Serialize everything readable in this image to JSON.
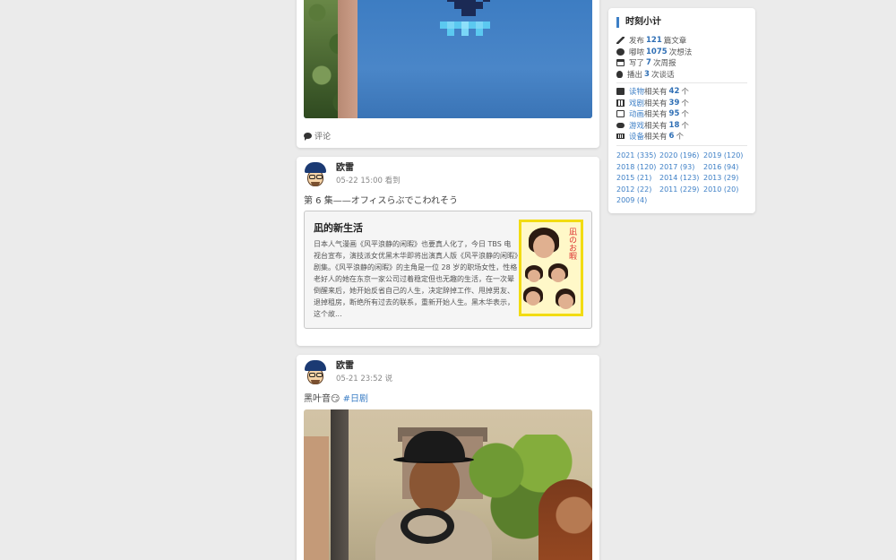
{
  "posts": [
    {
      "comment_label": "评论"
    },
    {
      "author": "欧雷",
      "time": "05-22 15:00",
      "verb": "看到",
      "text": "第 6 集——オフィスらぶでこわれそう",
      "embed": {
        "title": "凪的新生活",
        "summary": "日本人气漫画《风平浪静的闲暇》也要真人化了，今日 TBS 电视台宣布，演技派女优黑木华即将出演真人版《风平浪静的闲暇》剧集。《风平浪静的闲暇》的主角是一位 28 岁的职场女性，性格老好人的她在东京一家公司过着稳定但也无趣的生活，在一次晕倒醒来后，她开始反省自己的人生，决定辞掉工作、甩掉男友、退掉租房，断绝所有过去的联系，重新开始人生。黑木华表示，这个故...",
        "poster_title": "凪のお暇"
      }
    },
    {
      "author": "欧雷",
      "time": "05-21 23:52",
      "verb": "说",
      "text": "黑叶音😏",
      "tag": "#日剧"
    }
  ],
  "sidebar": {
    "title": "时刻小计",
    "stats": [
      {
        "icon": "pencil-icon",
        "pre": "发布",
        "num": "121",
        "post": "篇文章"
      },
      {
        "icon": "chat-icon",
        "pre": "嘟哝",
        "num": "1075",
        "post": "次想法"
      },
      {
        "icon": "calendar-icon",
        "pre": "写了",
        "num": "7",
        "post": "次周报"
      },
      {
        "icon": "microphone-icon",
        "pre": "播出",
        "num": "3",
        "post": "次谈话"
      }
    ],
    "media": [
      {
        "icon": "book-icon",
        "link": "读物",
        "pre": "相关有",
        "num": "42",
        "post": "个"
      },
      {
        "icon": "film-icon",
        "link": "戏剧",
        "pre": "相关有",
        "num": "39",
        "post": "个"
      },
      {
        "icon": "tv-icon",
        "link": "动画",
        "pre": "相关有",
        "num": "95",
        "post": "个"
      },
      {
        "icon": "gamepad-icon",
        "link": "游戏",
        "pre": "相关有",
        "num": "18",
        "post": "个"
      },
      {
        "icon": "keyboard-icon",
        "link": "设备",
        "pre": "相关有",
        "num": "6",
        "post": "个"
      }
    ],
    "years": [
      "2021 (335)",
      "2020 (196)",
      "2019 (120)",
      "2018 (120)",
      "2017 (93)",
      "2016 (94)",
      "2015 (21)",
      "2014 (123)",
      "2013 (29)",
      "2012 (22)",
      "2011 (229)",
      "2010 (20)",
      "2009 (4)"
    ]
  }
}
